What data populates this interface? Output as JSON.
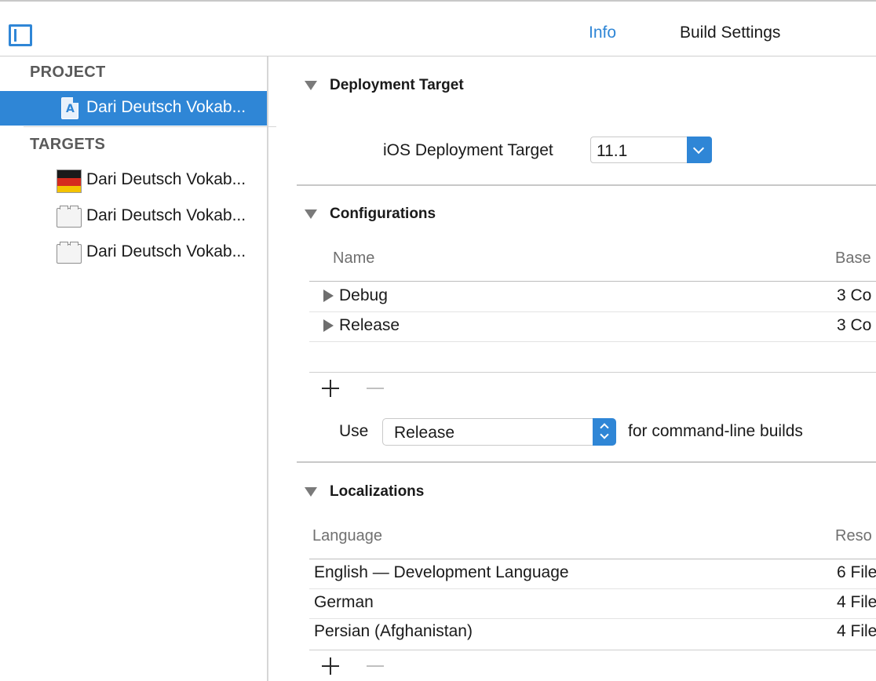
{
  "tabs": {
    "info": "Info",
    "build_settings": "Build Settings"
  },
  "sidebar": {
    "project_header": "PROJECT",
    "project_item": "Dari Deutsch Vokab...",
    "targets_header": "TARGETS",
    "targets": [
      {
        "label": "Dari Deutsch Vokab...",
        "icon": "app-flag-icon"
      },
      {
        "label": "Dari Deutsch Vokab...",
        "icon": "target-bundle-icon"
      },
      {
        "label": "Dari Deutsch Vokab...",
        "icon": "target-bundle-icon"
      }
    ]
  },
  "deployment": {
    "title": "Deployment Target",
    "field_label": "iOS Deployment Target",
    "field_value": "11.1"
  },
  "configurations": {
    "title": "Configurations",
    "col_name": "Name",
    "col_based": "Base",
    "rows": [
      {
        "name": "Debug",
        "based": "3 Co"
      },
      {
        "name": "Release",
        "based": "3 Co"
      }
    ],
    "use_label": "Use",
    "use_value": "Release",
    "use_suffix": "for command-line builds"
  },
  "localizations": {
    "title": "Localizations",
    "col_language": "Language",
    "col_resources": "Reso",
    "rows": [
      {
        "language": "English — Development Language",
        "resources": "6 File"
      },
      {
        "language": "German",
        "resources": "4 File"
      },
      {
        "language": "Persian (Afghanistan)",
        "resources": "4 File"
      }
    ]
  },
  "colors": {
    "accent": "#2f86d6"
  }
}
